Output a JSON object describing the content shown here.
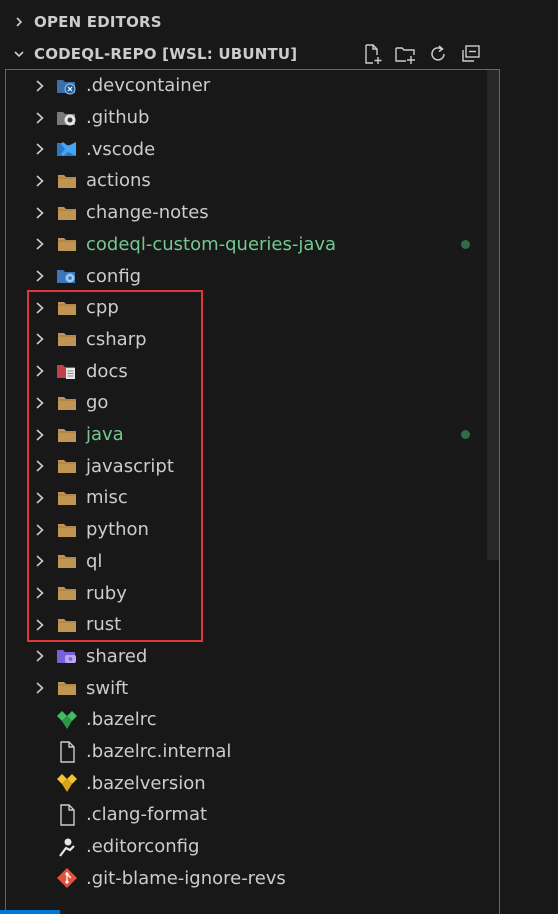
{
  "sections": {
    "open_editors": "OPEN EDITORS",
    "repo": "CODEQL-REPO [WSL: UBUNTU]"
  },
  "toolbar": {
    "new_file_icon": "new-file-icon",
    "new_folder_icon": "new-folder-icon",
    "refresh_icon": "refresh-icon",
    "collapse_icon": "collapse-all-icon"
  },
  "tree": {
    "items": [
      {
        "label": ".devcontainer",
        "type": "folder",
        "icon": "devcontainer-folder-icon"
      },
      {
        "label": ".github",
        "type": "folder",
        "icon": "github-folder-icon"
      },
      {
        "label": ".vscode",
        "type": "folder",
        "icon": "vscode-folder-icon"
      },
      {
        "label": "actions",
        "type": "folder",
        "icon": "folder-icon"
      },
      {
        "label": "change-notes",
        "type": "folder",
        "icon": "folder-icon"
      },
      {
        "label": "codeql-custom-queries-java",
        "type": "folder",
        "icon": "folder-icon",
        "modified": true
      },
      {
        "label": "config",
        "type": "folder",
        "icon": "config-folder-icon"
      },
      {
        "label": "cpp",
        "type": "folder",
        "icon": "folder-icon"
      },
      {
        "label": "csharp",
        "type": "folder",
        "icon": "folder-icon"
      },
      {
        "label": "docs",
        "type": "folder",
        "icon": "docs-folder-icon"
      },
      {
        "label": "go",
        "type": "folder",
        "icon": "folder-icon"
      },
      {
        "label": "java",
        "type": "folder",
        "icon": "folder-icon",
        "modified": true
      },
      {
        "label": "javascript",
        "type": "folder",
        "icon": "folder-icon"
      },
      {
        "label": "misc",
        "type": "folder",
        "icon": "folder-icon"
      },
      {
        "label": "python",
        "type": "folder",
        "icon": "folder-icon"
      },
      {
        "label": "ql",
        "type": "folder",
        "icon": "folder-icon"
      },
      {
        "label": "ruby",
        "type": "folder",
        "icon": "folder-icon"
      },
      {
        "label": "rust",
        "type": "folder",
        "icon": "folder-icon"
      },
      {
        "label": "shared",
        "type": "folder",
        "icon": "shared-folder-icon"
      },
      {
        "label": "swift",
        "type": "folder",
        "icon": "folder-icon"
      },
      {
        "label": ".bazelrc",
        "type": "file",
        "icon": "bazel-icon"
      },
      {
        "label": ".bazelrc.internal",
        "type": "file",
        "icon": "file-icon"
      },
      {
        "label": ".bazelversion",
        "type": "file",
        "icon": "bazel-yellow-icon"
      },
      {
        "label": ".clang-format",
        "type": "file",
        "icon": "file-icon"
      },
      {
        "label": ".editorconfig",
        "type": "file",
        "icon": "editorconfig-icon"
      },
      {
        "label": ".git-blame-ignore-revs",
        "type": "file",
        "icon": "git-icon"
      }
    ]
  },
  "colors": {
    "background": "#181818",
    "text": "#cccccc",
    "git_modified": "#73c991",
    "focus_border": "#2a73c8",
    "highlight_box": "#e0353b",
    "folder": "#c09553"
  }
}
